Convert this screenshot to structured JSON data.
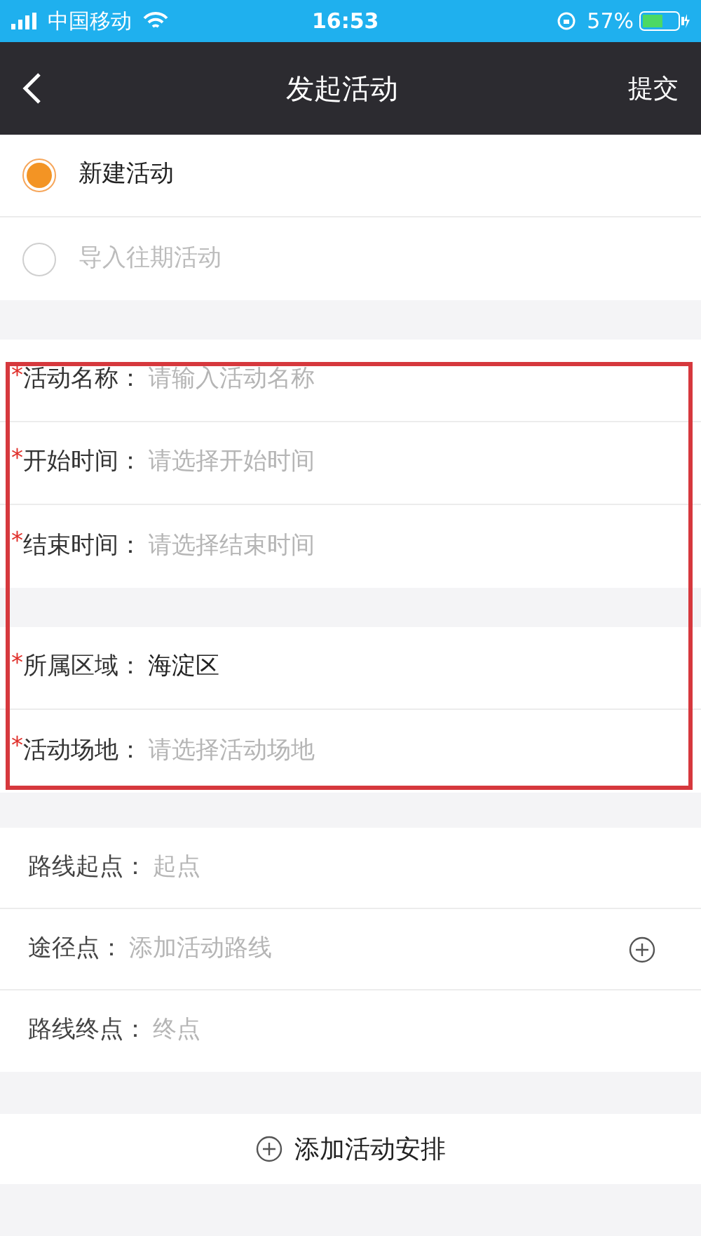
{
  "status_bar": {
    "carrier": "中国移动",
    "time": "16:53",
    "battery": "57%"
  },
  "nav": {
    "title": "发起活动",
    "action": "提交"
  },
  "modes": [
    {
      "label": "新建活动",
      "selected": true
    },
    {
      "label": "导入往期活动",
      "selected": false
    }
  ],
  "field_groups": [
    [
      {
        "required_mark": "*",
        "label": "活动名称：",
        "placeholder": "请输入活动名称"
      },
      {
        "required_mark": "*",
        "label": "开始时间：",
        "placeholder": "请选择开始时间"
      },
      {
        "required_mark": "*",
        "label": "结束时间：",
        "placeholder": "请选择结束时间"
      }
    ],
    [
      {
        "required_mark": "*",
        "label": "所属区域：",
        "value": "海淀区"
      },
      {
        "required_mark": "*",
        "label": "活动场地：",
        "placeholder": "请选择活动场地"
      }
    ]
  ],
  "route": [
    {
      "label": "路线起点：",
      "placeholder": "起点",
      "kind": "text"
    },
    {
      "label": "途径点：",
      "placeholder": "添加活动路线",
      "kind": "add"
    },
    {
      "label": "路线终点：",
      "placeholder": "终点",
      "kind": "text"
    }
  ],
  "add_schedule": "添加活动安排"
}
